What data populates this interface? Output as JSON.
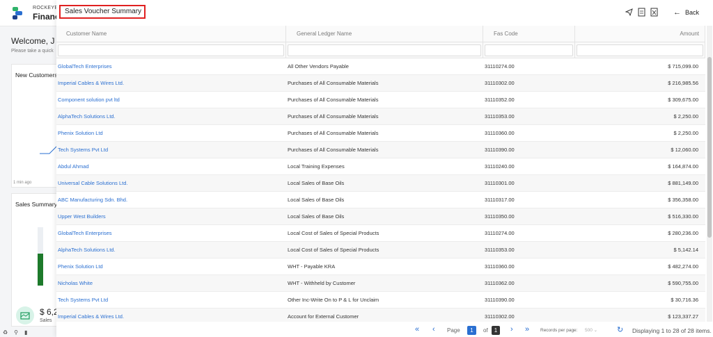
{
  "background": {
    "brand_top": "ROCKEYE",
    "brand_main": "Financ",
    "welcome": "Welcome, J",
    "subtitle": "Please take a quick",
    "card1_title": "New Customers",
    "card1_time": "1 min ago",
    "card2_title": "Sales Summary",
    "card2_value": "$ 6,2",
    "card2_label": "Sales",
    "bar_fill_ratio": 0.55
  },
  "panel": {
    "title": "Sales Voucher Summary",
    "back_label": "Back"
  },
  "table": {
    "headers": {
      "customer": "Customer Name",
      "gl": "General Ledger Name",
      "fas": "Fas Code",
      "amount": "Amount"
    },
    "rows": [
      {
        "customer": "GlobalTech Enterprises",
        "gl": "All Other Vendors Payable",
        "fas": "31110274.00",
        "amount": "$ 715,099.00"
      },
      {
        "customer": "Imperial Cables & Wires Ltd.",
        "gl": "Purchases of All Consumable Materials",
        "fas": "31110302.00",
        "amount": "$ 216,985.56"
      },
      {
        "customer": "Component solution pvt ltd",
        "gl": "Purchases of All Consumable Materials",
        "fas": "31110352.00",
        "amount": "$ 309,675.00"
      },
      {
        "customer": "AlphaTech Solutions Ltd.",
        "gl": "Purchases of All Consumable Materials",
        "fas": "31110353.00",
        "amount": "$ 2,250.00"
      },
      {
        "customer": "Phenix Solution Ltd",
        "gl": "Purchases of All Consumable Materials",
        "fas": "31110360.00",
        "amount": "$ 2,250.00"
      },
      {
        "customer": "Tech Systems Pvt Ltd",
        "gl": "Purchases of All Consumable Materials",
        "fas": "31110390.00",
        "amount": "$ 12,060.00"
      },
      {
        "customer": "Abdul Ahmad",
        "gl": "Local Training Expenses",
        "fas": "31110240.00",
        "amount": "$ 164,874.00"
      },
      {
        "customer": "Universal Cable Solutions Ltd.",
        "gl": "Local Sales of Base Oils",
        "fas": "31110301.00",
        "amount": "$ 881,149.00"
      },
      {
        "customer": "ABC Manufacturing Sdn. Bhd.",
        "gl": "Local Sales of Base Oils",
        "fas": "31110317.00",
        "amount": "$ 356,358.00"
      },
      {
        "customer": "Upper West Builders",
        "gl": "Local Sales of Base Oils",
        "fas": "31110350.00",
        "amount": "$ 516,330.00"
      },
      {
        "customer": "GlobalTech Enterprises",
        "gl": "Local Cost of Sales of Special Products",
        "fas": "31110274.00",
        "amount": "$ 280,236.00"
      },
      {
        "customer": "AlphaTech Solutions Ltd.",
        "gl": "Local Cost of Sales of Special Products",
        "fas": "31110353.00",
        "amount": "$ 5,142.14"
      },
      {
        "customer": "Phenix Solution Ltd",
        "gl": "WHT - Payable KRA",
        "fas": "31110360.00",
        "amount": "$ 482,274.00"
      },
      {
        "customer": "Nicholas White",
        "gl": "WHT - Withheld by Customer",
        "fas": "31110362.00",
        "amount": "$ 590,755.00"
      },
      {
        "customer": "Tech Systems Pvt Ltd",
        "gl": "Other Inc-Write On to P & L for Unclaim",
        "fas": "31110390.00",
        "amount": "$ 30,716.36"
      },
      {
        "customer": "Imperial Cables & Wires Ltd.",
        "gl": "Account for External Customer",
        "fas": "31110302.00",
        "amount": "$ 123,337.27"
      }
    ]
  },
  "pagination": {
    "page_label": "Page",
    "current_page": "1",
    "of_label": "of",
    "total_pages": "1",
    "records_label": "Records per page:",
    "records_value": "500",
    "display_text": "Displaying 1 to 28 of 28 items."
  },
  "colors": {
    "accent": "#2a6fd1",
    "highlight_border": "#e02020",
    "bar_green": "#1d7a2b"
  }
}
